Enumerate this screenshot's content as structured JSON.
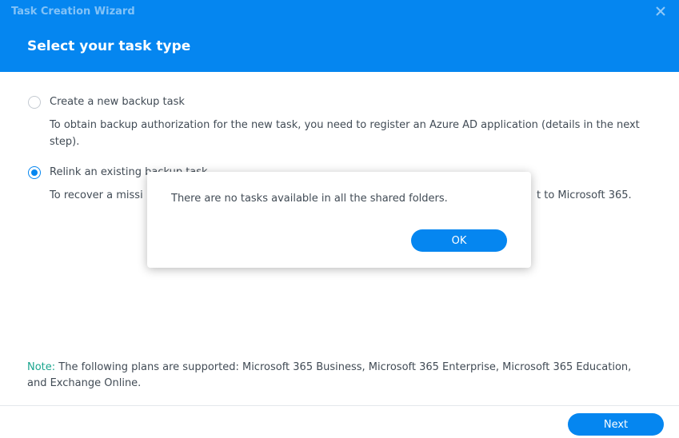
{
  "window": {
    "title": "Task Creation Wizard",
    "close_icon": "close-icon"
  },
  "page": {
    "title": "Select your task type"
  },
  "options": [
    {
      "label": "Create a new backup task",
      "description": "To obtain backup authorization for the new task, you need to register an Azure AD application (details in the next step).",
      "selected": false
    },
    {
      "label": "Relink an existing backup task",
      "description_left": "To recover a missi",
      "description_right": "t to Microsoft 365.",
      "selected": true
    }
  ],
  "note": {
    "label": "Note:",
    "text": " The following plans are supported: Microsoft 365 Business, Microsoft 365 Enterprise, Microsoft 365 Education, and Exchange Online."
  },
  "footer": {
    "next_label": "Next"
  },
  "dialog": {
    "message": "There are no tasks available in all the shared folders.",
    "ok_label": "OK"
  },
  "colors": {
    "accent": "#0586f0",
    "note_label": "#1aa58e",
    "text": "#414b55"
  }
}
